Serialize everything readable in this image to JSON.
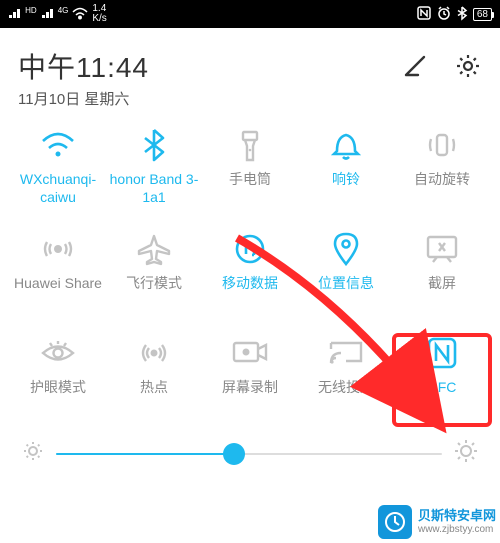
{
  "status_bar": {
    "net_speed": "1.4\nK/s",
    "battery": "68"
  },
  "header": {
    "time": "中午11:44",
    "date": "11月10日 星期六"
  },
  "tiles": [
    {
      "label": "WXchuanqi-caiwu",
      "active": true
    },
    {
      "label": "honor Band 3-1a1",
      "active": true
    },
    {
      "label": "手电筒",
      "active": false
    },
    {
      "label": "响铃",
      "active": true
    },
    {
      "label": "自动旋转",
      "active": false
    },
    {
      "label": "Huawei Share",
      "active": false
    },
    {
      "label": "飞行模式",
      "active": false
    },
    {
      "label": "移动数据",
      "active": true
    },
    {
      "label": "位置信息",
      "active": true
    },
    {
      "label": "截屏",
      "active": false
    },
    {
      "label": "护眼模式",
      "active": false
    },
    {
      "label": "热点",
      "active": false
    },
    {
      "label": "屏幕录制",
      "active": false
    },
    {
      "label": "无线投屏",
      "active": false
    },
    {
      "label": "NFC",
      "active": true
    }
  ],
  "brightness": {
    "percent": 46
  },
  "watermark": {
    "title": "贝斯特安卓网",
    "url": "www.zjbstyy.com"
  }
}
